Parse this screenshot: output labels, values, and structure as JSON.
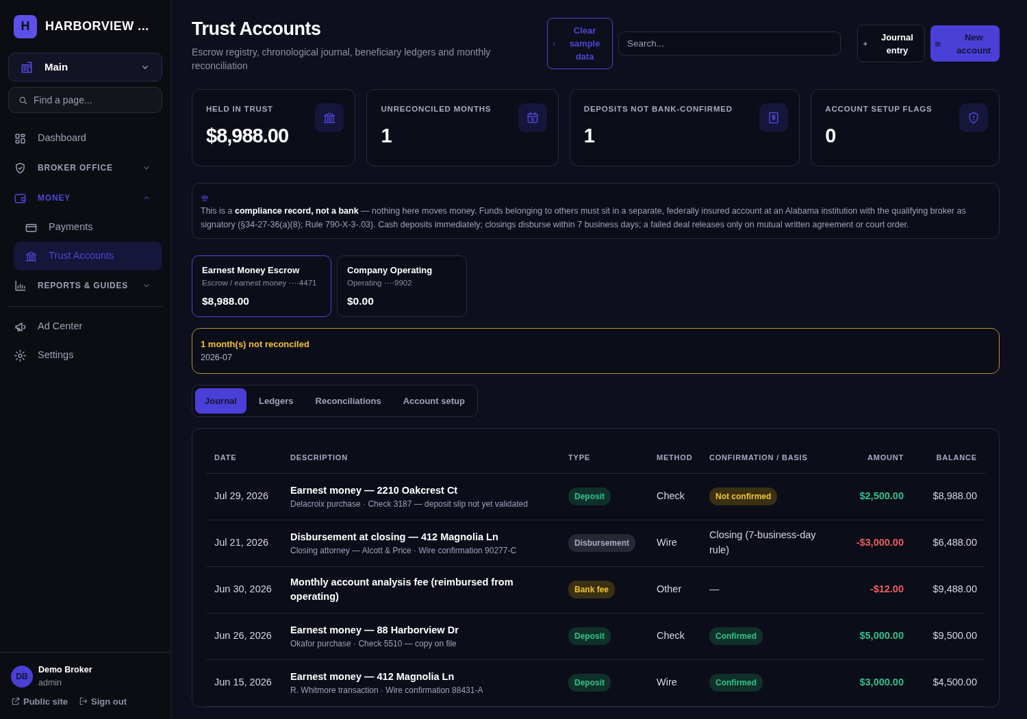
{
  "brand": {
    "logo": "H",
    "name": "HARBORVIEW ..."
  },
  "workspace": {
    "label": "Main"
  },
  "page_search": {
    "placeholder": "Find a page..."
  },
  "nav": [
    {
      "kind": "link",
      "label": "Dashboard",
      "selected": false
    },
    {
      "kind": "section",
      "label": "BROKER OFFICE",
      "expanded": false,
      "selected": false
    },
    {
      "kind": "section",
      "label": "MONEY",
      "expanded": true,
      "selected": true
    },
    {
      "kind": "sublink",
      "label": "Payments",
      "selected": false
    },
    {
      "kind": "sublink",
      "label": "Trust Accounts",
      "selected": true
    },
    {
      "kind": "section",
      "label": "REPORTS & GUIDES",
      "expanded": false,
      "selected": false
    },
    {
      "kind": "divider"
    },
    {
      "kind": "link",
      "label": "Ad Center",
      "selected": false
    },
    {
      "kind": "link",
      "label": "Settings",
      "selected": false
    }
  ],
  "user": {
    "initials": "DB",
    "name": "Demo Broker",
    "role": "admin",
    "links": [
      "Public site",
      "Sign out"
    ]
  },
  "header": {
    "title": "Trust Accounts",
    "subtitle": "Escrow registry, chronological journal, beneficiary ledgers and monthly reconciliation"
  },
  "actions": {
    "clear": "Clear sample data",
    "search_placeholder": "Search...",
    "journal": "Journal entry",
    "new_account": "New account"
  },
  "stats": [
    {
      "label": "HELD IN TRUST",
      "value": "$8,988.00"
    },
    {
      "label": "UNRECONCILED MONTHS",
      "value": "1"
    },
    {
      "label": "DEPOSITS NOT BANK-CONFIRMED",
      "value": "1"
    },
    {
      "label": "ACCOUNT SETUP FLAGS",
      "value": "0"
    }
  ],
  "notice": "This is a **compliance record, not a bank** — nothing here moves money. Funds belonging to others must sit in a separate, federally insured account at an Alabama institution with the qualifying broker as signatory (§34-27-36(a)(8); Rule 790-X-3-.03). Cash deposits immediately; closings disburse within 7 business days; a failed deal releases only on mutual written agreement or court order.",
  "accounts": [
    {
      "name": "Earnest Money Escrow",
      "detail": "Escrow / earnest money ····4471",
      "balance": "$8,988.00",
      "selected": true
    },
    {
      "name": "Company Operating",
      "detail": "Operating ····9902",
      "balance": "$0.00",
      "selected": false
    }
  ],
  "alert": {
    "title": "1 month(s) not reconciled",
    "months": "2026-07"
  },
  "tabs": [
    {
      "label": "Journal",
      "selected": true
    },
    {
      "label": "Ledgers",
      "selected": false
    },
    {
      "label": "Reconciliations",
      "selected": false
    },
    {
      "label": "Account setup",
      "selected": false
    }
  ],
  "table": {
    "columns": [
      "DATE",
      "DESCRIPTION",
      "TYPE",
      "METHOD",
      "CONFIRMATION / BASIS",
      "AMOUNT",
      "BALANCE"
    ],
    "rows": [
      {
        "date": "Jul 29, 2026",
        "title": "Earnest money — 2210 Oakcrest Ct",
        "note": "Delacroix purchase · Check 3187 — deposit slip not yet validated",
        "type": {
          "label": "Deposit",
          "kind": "deposit"
        },
        "method": "Check",
        "confirmation": {
          "label": "Not confirmed",
          "kind": "pending"
        },
        "amount": {
          "text": "$2,500.00",
          "kind": "credit"
        },
        "balance": "$8,988.00"
      },
      {
        "date": "Jul 21, 2026",
        "title": "Disbursement at closing — 412 Magnolia Ln",
        "note": "Closing attorney — Alcott & Price · Wire confirmation 90277-C",
        "type": {
          "label": "Disbursement",
          "kind": "disbursement"
        },
        "method": "Wire",
        "confirmation": {
          "label": "Closing (7-business-day rule)",
          "kind": "text"
        },
        "amount": {
          "text": "-$3,000.00",
          "kind": "debit"
        },
        "balance": "$6,488.00"
      },
      {
        "date": "Jun 30, 2026",
        "title": "Monthly account analysis fee (reimbursed from operating)",
        "type": {
          "label": "Bank fee",
          "kind": "fee"
        },
        "method": "Other",
        "confirmation": {
          "label": "—",
          "kind": "text"
        },
        "amount": {
          "text": "-$12.00",
          "kind": "debit"
        },
        "balance": "$9,488.00"
      },
      {
        "date": "Jun 26, 2026",
        "title": "Earnest money — 88 Harborview Dr",
        "note": "Okafor purchase · Check 5510 — copy on file",
        "type": {
          "label": "Deposit",
          "kind": "deposit"
        },
        "method": "Check",
        "confirmation": {
          "label": "Confirmed",
          "kind": "confirmed"
        },
        "amount": {
          "text": "$5,000.00",
          "kind": "credit"
        },
        "balance": "$9,500.00"
      },
      {
        "date": "Jun 15, 2026",
        "title": "Earnest money — 412 Magnolia Ln",
        "note": "R. Whitmore transaction · Wire confirmation 88431-A",
        "type": {
          "label": "Deposit",
          "kind": "deposit"
        },
        "method": "Wire",
        "confirmation": {
          "label": "Confirmed",
          "kind": "confirmed"
        },
        "amount": {
          "text": "$3,000.00",
          "kind": "credit"
        },
        "balance": "$4,500.00"
      }
    ]
  }
}
